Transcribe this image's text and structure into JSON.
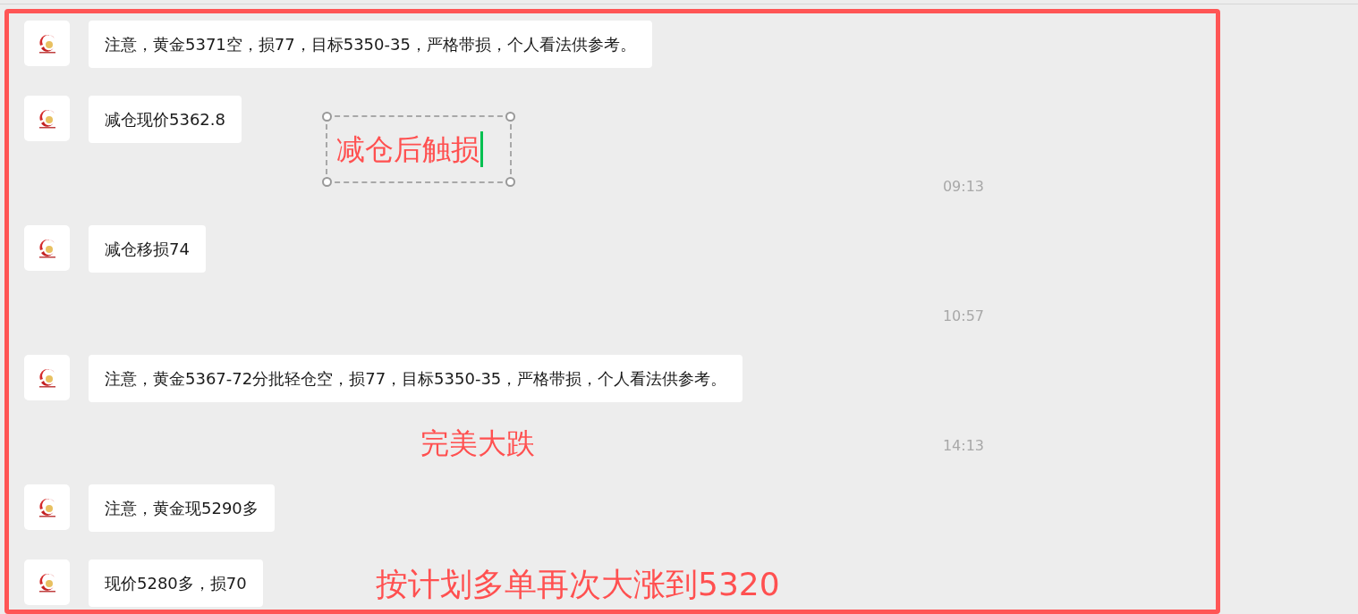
{
  "chat": [
    {
      "kind": "message",
      "text": "注意，黄金5371空，损77，目标5350-35，严格带损，个人看法供参考。"
    },
    {
      "kind": "message",
      "text": "减仓现价5362.8"
    },
    {
      "kind": "time",
      "text": "09:13"
    },
    {
      "kind": "message",
      "text": "减仓移损74"
    },
    {
      "kind": "time",
      "text": "10:57"
    },
    {
      "kind": "message",
      "text": "注意，黄金5367-72分批轻仓空，损77，目标5350-35，严格带损，个人看法供参考。"
    },
    {
      "kind": "time",
      "text": "14:13"
    },
    {
      "kind": "message",
      "text": "注意，黄金现5290多"
    },
    {
      "kind": "message",
      "text": "现价5280多，损70"
    }
  ],
  "annotations": [
    {
      "kind": "textbox",
      "text": "减仓后触损"
    },
    {
      "kind": "plain",
      "text": "完美大跌"
    },
    {
      "kind": "plain",
      "text": "按计划多单再次大涨到5320"
    }
  ]
}
